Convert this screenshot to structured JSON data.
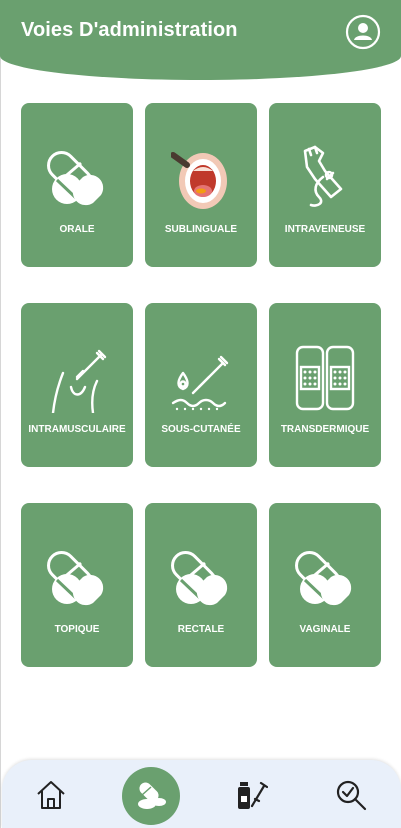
{
  "header": {
    "title": "Voies D'administration",
    "profile_icon": "user-circle-icon"
  },
  "routes": [
    {
      "label": "ORALE",
      "icon": "pill-capsule-icon"
    },
    {
      "label": "SUBLINGUALE",
      "icon": "open-mouth-icon"
    },
    {
      "label": "INTRAVEINEUSE",
      "icon": "iv-arm-icon"
    },
    {
      "label": "INTRAMUSCULAIRE",
      "icon": "hip-injection-icon"
    },
    {
      "label": "SOUS-CUTANÉE",
      "icon": "skin-injection-icon"
    },
    {
      "label": "TRANSDERMIQUE",
      "icon": "patch-icon"
    },
    {
      "label": "TOPIQUE",
      "icon": "pill-capsule-icon"
    },
    {
      "label": "RECTALE",
      "icon": "pill-capsule-icon"
    },
    {
      "label": "VAGINALE",
      "icon": "pill-capsule-icon"
    }
  ],
  "bottom_nav": {
    "items": [
      "home-icon",
      "pills-icon",
      "bottle-syringe-icon",
      "search-check-icon"
    ],
    "active_index": 1
  },
  "colors": {
    "primary": "#6aa06f",
    "nav_background": "#e9f0fa"
  }
}
